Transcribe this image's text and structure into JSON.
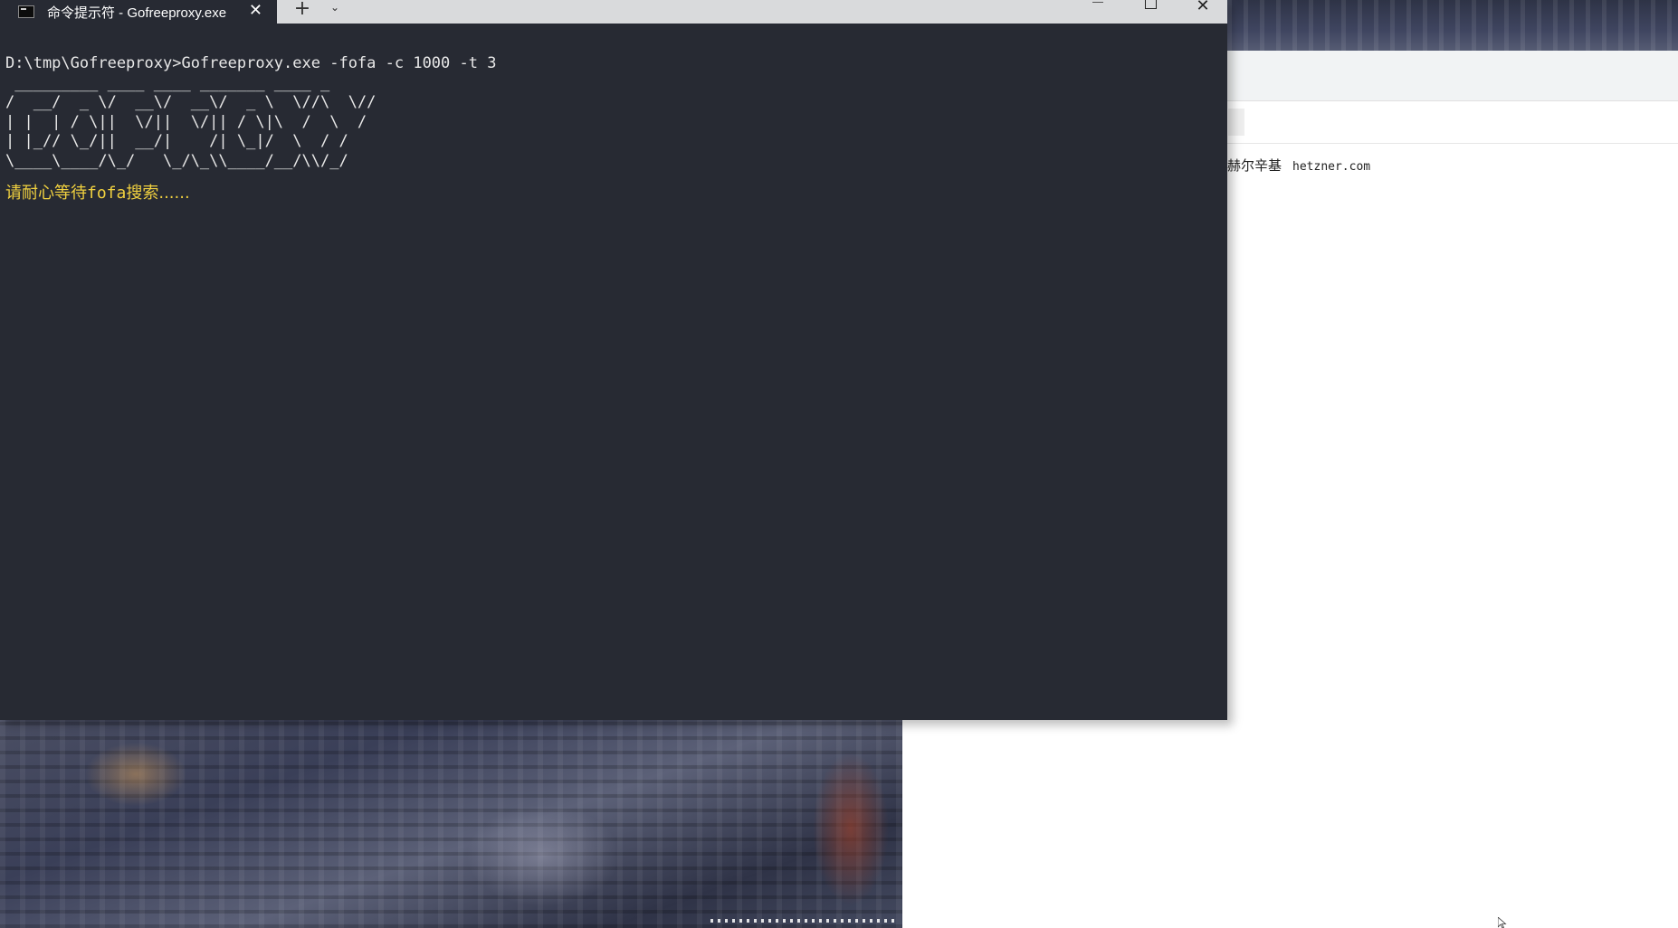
{
  "terminal": {
    "tab_title": "命令提示符 - Gofreeproxy.exe",
    "tab_icon": "console-icon",
    "command_line": "D:\\tmp\\Gofreeproxy>Gofreeproxy.exe -fofa -c 1000 -t 3",
    "banner_lines": [
      " _________ ____ ____ _______ ____ _",
      "/  __/  _ \\/  __\\/  __\\/  _ \\  \\//\\  \\//",
      "| |  | / \\||  \\/||  \\/|| / \\|\\  /  \\  /",
      "| |_// \\_/||  __/|    /| \\_|/  \\  / /",
      "\\____\\____/\\_/   \\_/\\_\\\\____/__/\\\\/_/"
    ],
    "wait_message_prefix": "请耐心等待",
    "wait_message_keyword": "fofa",
    "wait_message_suffix": "搜索......",
    "colors": {
      "background": "#272a33",
      "text": "#e8e8e8",
      "highlight": "#f1d13f"
    }
  },
  "titlebar": {
    "new_tab": "+",
    "dropdown": "⌄",
    "close_tab": "✕",
    "close_window": "✕"
  },
  "browser": {
    "result_city": "赫尔辛基",
    "result_domain": "hetzner.com"
  }
}
